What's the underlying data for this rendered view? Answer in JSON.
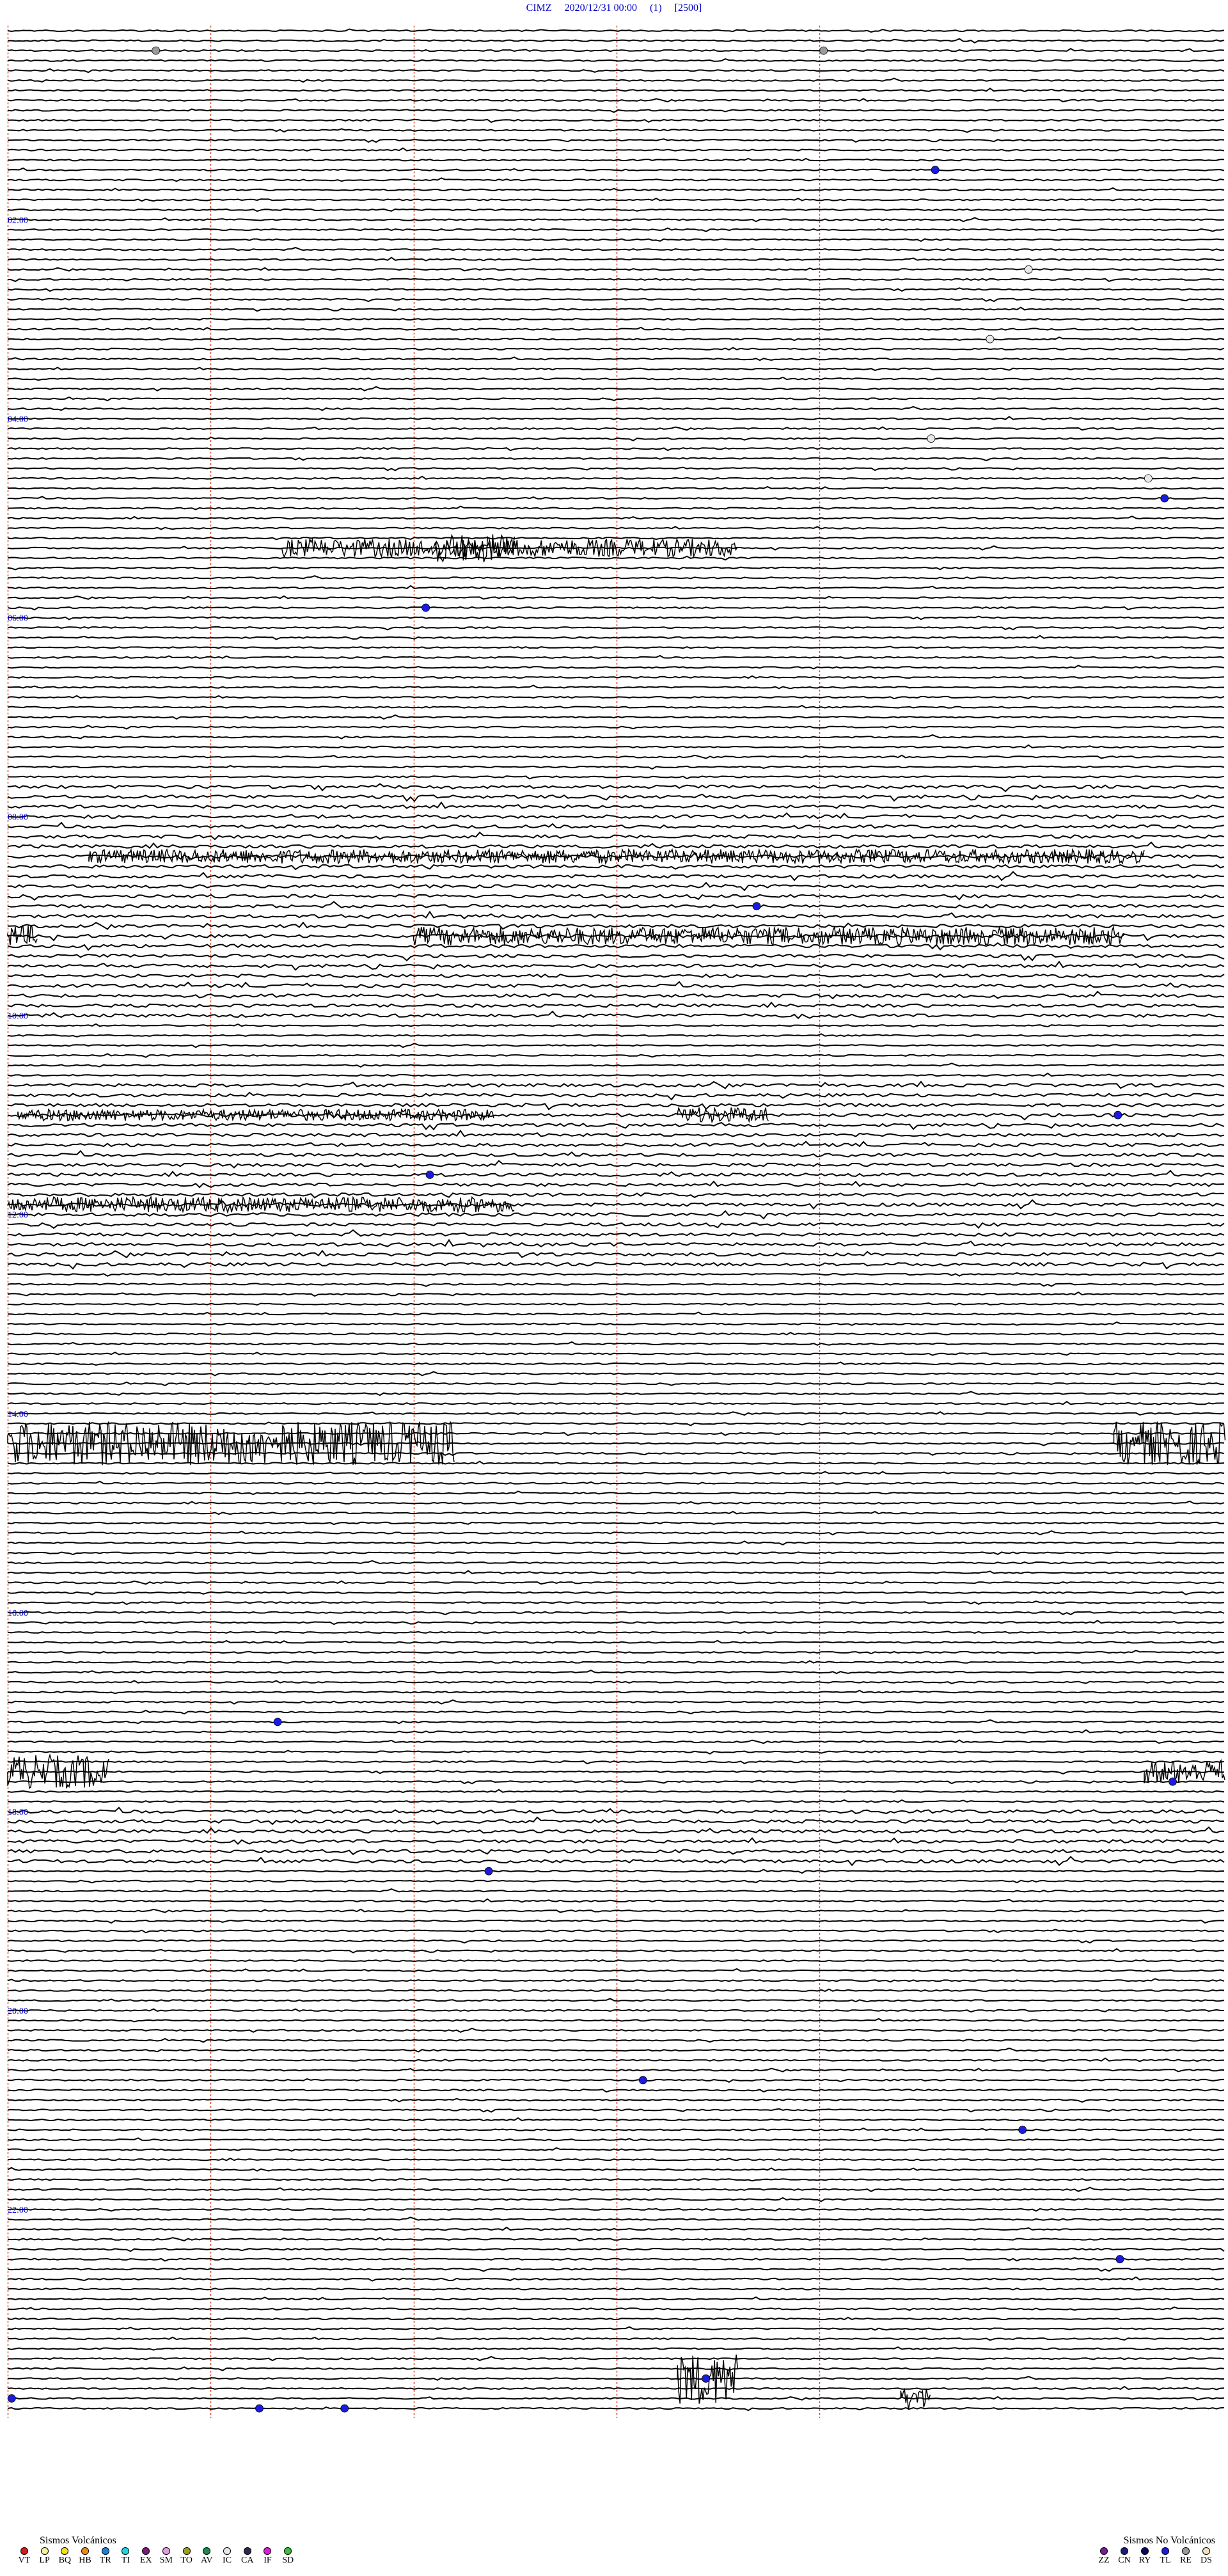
{
  "header": {
    "station": "CIMZ",
    "datetime": "2020/12/31 00:00",
    "channel": "(1)",
    "scale": "[2500]"
  },
  "chart_data": {
    "type": "helicorder",
    "title": "CIMZ 2020/12/31 00:00 (1) [2500]",
    "time_labels": [
      "02:00",
      "04:00",
      "06:00",
      "08:00",
      "10:00",
      "12:00",
      "14:00",
      "16:00",
      "18:00",
      "20:00",
      "22:00"
    ],
    "hour_marker_label": "14:00",
    "trace_count": 240,
    "minutes_per_trace": 6,
    "grid_minutes": [
      0,
      1,
      2,
      3,
      4
    ],
    "events": [
      {
        "trace": 2,
        "minute": 0.73,
        "type": "RE"
      },
      {
        "trace": 2,
        "minute": 4.02,
        "type": "RE"
      },
      {
        "trace": 14,
        "minute": 4.57,
        "type": "TL"
      },
      {
        "trace": 24,
        "minute": 5.03,
        "type": "IC"
      },
      {
        "trace": 31,
        "minute": 4.84,
        "type": "IC"
      },
      {
        "trace": 41,
        "minute": 4.55,
        "type": "IC"
      },
      {
        "trace": 45,
        "minute": 5.62,
        "type": "IC"
      },
      {
        "trace": 47,
        "minute": 5.7,
        "type": "TL"
      },
      {
        "trace": 58,
        "minute": 2.06,
        "type": "TL"
      },
      {
        "trace": 88,
        "minute": 3.69,
        "type": "TL"
      },
      {
        "trace": 109,
        "minute": 5.47,
        "type": "TL"
      },
      {
        "trace": 115,
        "minute": 2.08,
        "type": "TL"
      },
      {
        "trace": 170,
        "minute": 1.33,
        "type": "TL"
      },
      {
        "trace": 176,
        "minute": 5.74,
        "type": "TL"
      },
      {
        "trace": 185,
        "minute": 2.37,
        "type": "TL"
      },
      {
        "trace": 206,
        "minute": 3.13,
        "type": "TL"
      },
      {
        "trace": 211,
        "minute": 5.0,
        "type": "TL"
      },
      {
        "trace": 224,
        "minute": 5.48,
        "type": "TL"
      },
      {
        "trace": 236,
        "minute": 3.44,
        "type": "TL"
      },
      {
        "trace": 238,
        "minute": 0.02,
        "type": "TL"
      },
      {
        "trace": 239,
        "minute": 1.24,
        "type": "TL"
      },
      {
        "trace": 239,
        "minute": 1.66,
        "type": "TL"
      }
    ],
    "bursts": [
      {
        "trace": 52,
        "start": 1.35,
        "end": 3.6,
        "amp": 14
      },
      {
        "trace": 52,
        "start": 2.1,
        "end": 2.5,
        "amp": 22
      },
      {
        "trace": 83,
        "start": 0.4,
        "end": 5.6,
        "amp": 11
      },
      {
        "trace": 91,
        "start": 2.0,
        "end": 5.5,
        "amp": 14
      },
      {
        "trace": 91,
        "start": 0.0,
        "end": 0.15,
        "amp": 16
      },
      {
        "trace": 109,
        "start": 0.05,
        "end": 2.4,
        "amp": 9
      },
      {
        "trace": 109,
        "start": 3.3,
        "end": 3.75,
        "amp": 12
      },
      {
        "trace": 118,
        "start": 0.0,
        "end": 2.5,
        "amp": 12
      },
      {
        "trace": 142,
        "start": 0.0,
        "end": 2.2,
        "amp": 34
      },
      {
        "trace": 142,
        "start": 5.45,
        "end": 6.0,
        "amp": 34
      },
      {
        "trace": 175,
        "start": 0.0,
        "end": 0.5,
        "amp": 26
      },
      {
        "trace": 175,
        "start": 5.6,
        "end": 6.0,
        "amp": 18
      },
      {
        "trace": 236,
        "start": 3.3,
        "end": 3.6,
        "amp": 40
      },
      {
        "trace": 238,
        "start": 4.4,
        "end": 4.55,
        "amp": 18
      }
    ]
  },
  "legend": {
    "volcanic_title": "Sismos Volcánicos",
    "volcanic": [
      {
        "code": "VT",
        "color": "#d81b1b"
      },
      {
        "code": "LP",
        "color": "#f3f0a0"
      },
      {
        "code": "BQ",
        "color": "#f4e11b"
      },
      {
        "code": "HB",
        "color": "#f08a1b"
      },
      {
        "code": "TR",
        "color": "#1b7fe0"
      },
      {
        "code": "TI",
        "color": "#1bd8e0"
      },
      {
        "code": "EX",
        "color": "#7a1b7a"
      },
      {
        "code": "SM",
        "color": "#e0a0e0"
      },
      {
        "code": "TO",
        "color": "#a0a020"
      },
      {
        "code": "AV",
        "color": "#1b8a4a"
      },
      {
        "code": "IC",
        "color": "#e8e8e8"
      },
      {
        "code": "CA",
        "color": "#2a2a4a"
      },
      {
        "code": "IF",
        "color": "#e01bd8"
      },
      {
        "code": "SD",
        "color": "#3ac03a"
      }
    ],
    "nonvolcanic_title": "Sismos No Volcánicos",
    "nonvolcanic": [
      {
        "code": "ZZ",
        "color": "#7a1b9a"
      },
      {
        "code": "CN",
        "color": "#1b1b7a"
      },
      {
        "code": "RY",
        "color": "#0a0a5a"
      },
      {
        "code": "TL",
        "color": "#1b1be0"
      },
      {
        "code": "RE",
        "color": "#9a9a9a"
      },
      {
        "code": "DS",
        "color": "#f0e0c0"
      }
    ]
  }
}
